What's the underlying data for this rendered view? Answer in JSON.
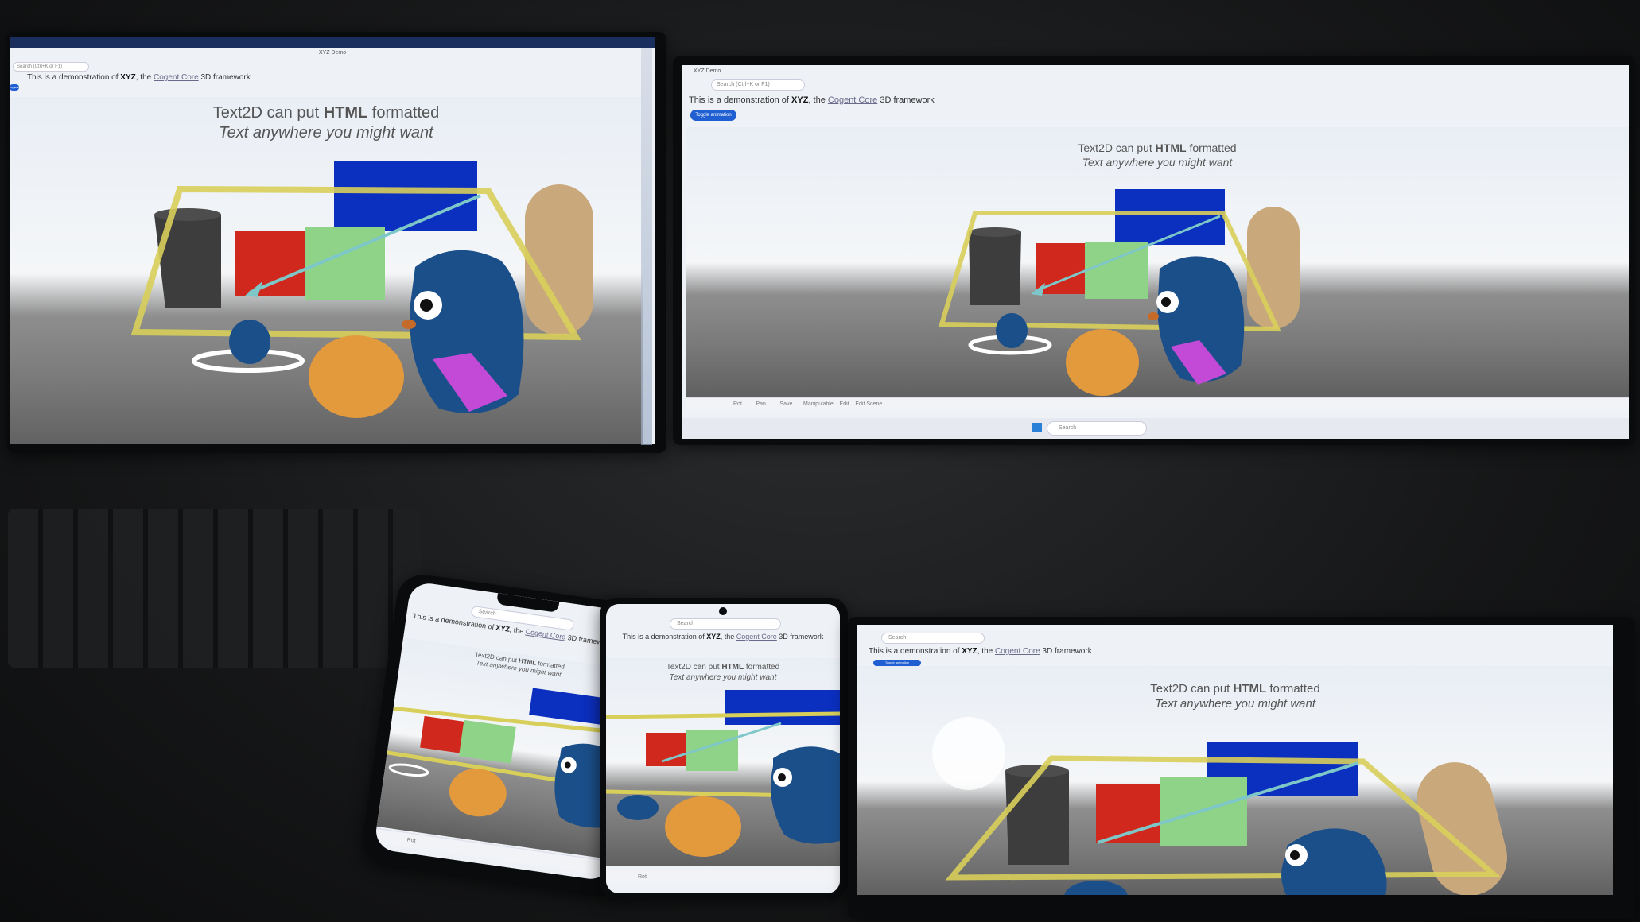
{
  "demo": {
    "window_title": "XYZ Demo",
    "search_placeholder": "Search (Ctrl+K or F1)",
    "search_short": "Search",
    "description_prefix": "This is a demonstration of ",
    "description_bold": "XYZ",
    "description_mid": ", the ",
    "description_link": "Cogent Core",
    "description_suffix": " 3D framework",
    "toggle_button": "Toggle animation",
    "text2d_prefix": "Text2D can put ",
    "text2d_bold": "HTML",
    "text2d_suffix": " formatted",
    "text2d_line2_a": "Text anywhere you might ",
    "text2d_line2_b": "want"
  },
  "toolbar": {
    "items": [
      "Rot",
      "Pan",
      "Save",
      "Manipulable",
      "Edit",
      "Edit Scene"
    ]
  },
  "taskbar": {
    "search": "Search"
  },
  "colors": {
    "sky": "#eef1f6",
    "floor": "#7a7a7a",
    "blue_box": "#0b2fbf",
    "red_box": "#d0281c",
    "green_box": "#8fd389",
    "capsule": "#c9a87c",
    "cylinder": "#3d3d3d",
    "orange_sphere": "#e39a3c",
    "gopher": "#1b4f8a",
    "purple_bar": "#c24ad6",
    "frame": "#d8cf5a",
    "arrow": "#7ec7c9",
    "toggle": "#1f5fd1"
  },
  "icons": [
    "search-icon",
    "back-icon",
    "rotate-icon",
    "pan-icon",
    "save-icon",
    "windows-start-icon"
  ]
}
